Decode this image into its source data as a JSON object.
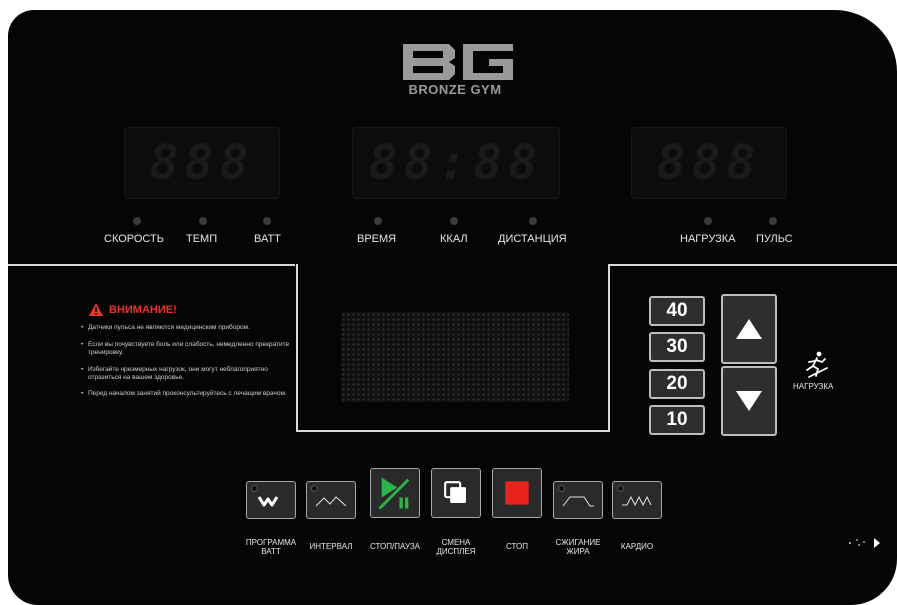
{
  "brand": {
    "name": "BRONZE GYM"
  },
  "displays": {
    "left": {
      "readout": "888"
    },
    "center": {
      "readout": "88:88"
    },
    "right": {
      "readout": "888"
    }
  },
  "indicators": {
    "speed": "СКОРОСТЬ",
    "tempo": "ТЕМП",
    "watt": "ВАТТ",
    "time": "ВРЕМЯ",
    "kcal": "ККАЛ",
    "distance": "ДИСТАНЦИЯ",
    "load": "НАГРУЗКА",
    "pulse": "ПУЛЬС"
  },
  "warning": {
    "title": "ВНИМАНИЕ!",
    "items": [
      "Датчики пульса не являются медицинским прибором.",
      "Если вы почувствуете боль или слабость, немедленно прекратите тренировку.",
      "Избегайте чрезмерных нагрузок, они могут неблагоприятно отразиться на вашем здоровье.",
      "Перед началом занятий проконсультируйтесь с лечащим врачом."
    ],
    "accent_color": "#e8322c"
  },
  "load_levels": [
    "40",
    "30",
    "20",
    "10"
  ],
  "load_label": "НАГРУЗКА",
  "programs": {
    "watt_program": "ПРОГРАММА\nВАТТ",
    "interval": "ИНТЕРВАЛ",
    "start_pause": "СТОП/ПАУЗА",
    "display_change": "СМЕНА\nДИСПЛЕЯ",
    "stop": "СТОП",
    "fat_burn": "СЖИГАНИЕ\nЖИРА",
    "cardio": "КАРДИО"
  },
  "colors": {
    "start_green": "#2db34a",
    "stop_red": "#e8231c",
    "panel_bg": "#050505"
  },
  "icons": [
    "warning-icon",
    "watt-program-icon",
    "interval-icon",
    "start-pause-icon",
    "display-change-icon",
    "stop-icon",
    "fat-burn-icon",
    "cardio-icon",
    "arrow-up-icon",
    "arrow-down-icon",
    "runner-icon",
    "nfc-icon"
  ]
}
